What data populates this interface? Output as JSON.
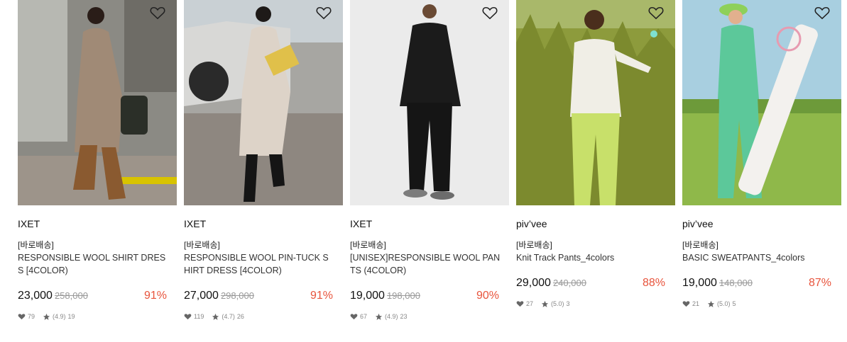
{
  "products": [
    {
      "brand": "IXET",
      "tag": "[바로배송]",
      "name": "RESPONSIBLE WOOL SHIRT DRESS [4COLOR)",
      "price": "23,000",
      "original_price": "258,000",
      "discount": "91%",
      "likes": "79",
      "rating": "(4.9)",
      "reviews": "19",
      "photo_bg": "#8f8a80",
      "garment_color": "#a08a76",
      "heart_color": "#222222"
    },
    {
      "brand": "IXET",
      "tag": "[바로배송]",
      "name": "RESPONSIBLE WOOL PIN-TUCK SHIRT DRESS [4COLOR)",
      "price": "27,000",
      "original_price": "298,000",
      "discount": "91%",
      "likes": "119",
      "rating": "(4.7)",
      "reviews": "26",
      "photo_bg": "#9a9a98",
      "garment_color": "#ddd3c8",
      "heart_color": "#222222"
    },
    {
      "brand": "IXET",
      "tag": "[바로배송]",
      "name": "[UNISEX]RESPONSIBLE WOOL PANTS (4COLOR)",
      "price": "19,000",
      "original_price": "198,000",
      "discount": "90%",
      "likes": "67",
      "rating": "(4.9)",
      "reviews": "23",
      "photo_bg": "#ececec",
      "garment_color": "#1b1b1b",
      "heart_color": "#222222"
    },
    {
      "brand": "piv’vee",
      "tag": "[바로배송]",
      "name": "Knit Track Pants_4colors",
      "price": "29,000",
      "original_price": "240,000",
      "discount": "88%",
      "likes": "27",
      "rating": "(5.0)",
      "reviews": "3",
      "photo_bg": "#8a9a3a",
      "garment_color": "#c8e06a",
      "heart_color": "#222222"
    },
    {
      "brand": "piv’vee",
      "tag": "[바로배송]",
      "name": "BASIC SWEATPANTS_4colors",
      "price": "19,000",
      "original_price": "148,000",
      "discount": "87%",
      "likes": "21",
      "rating": "(5.0)",
      "reviews": "5",
      "photo_bg": "#9cc4d8",
      "garment_color": "#5cc89a",
      "heart_color": "#222222"
    }
  ],
  "colors": {
    "discount": "#e8543c",
    "meta": "#888888"
  }
}
